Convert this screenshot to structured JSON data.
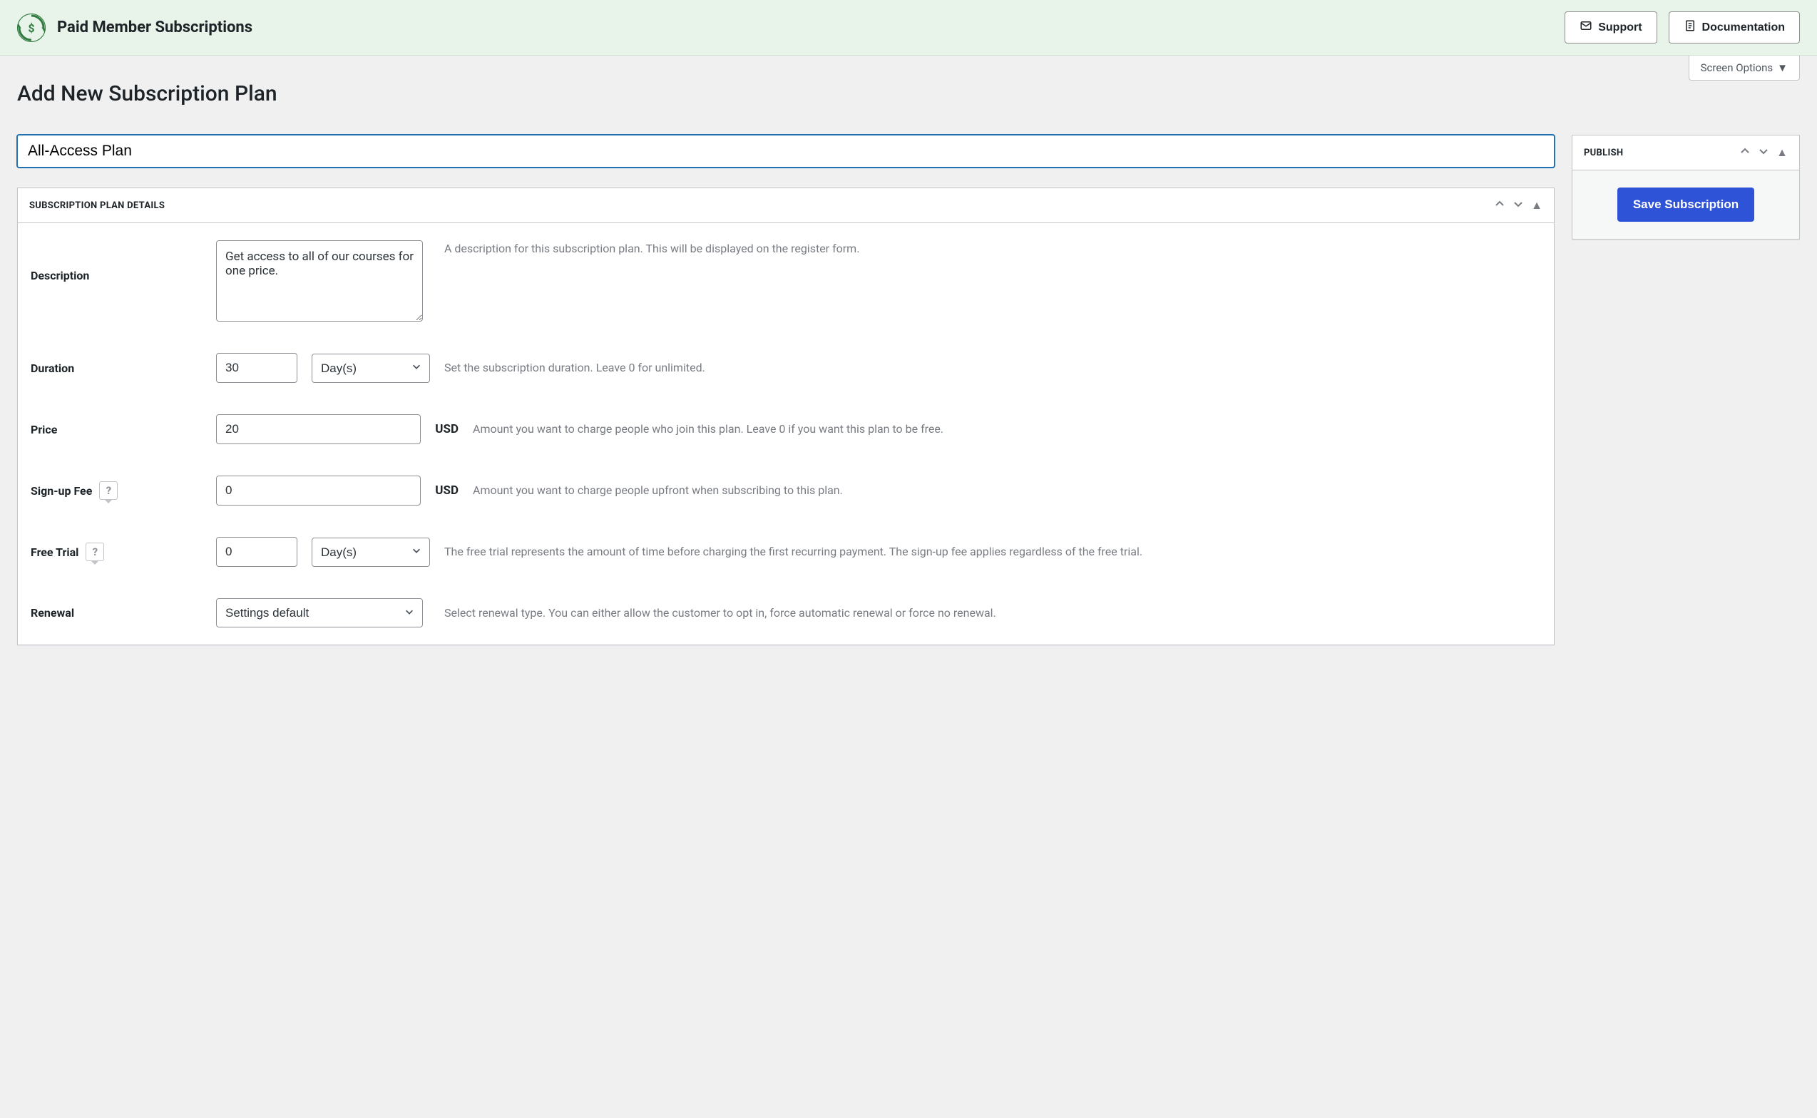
{
  "banner": {
    "title": "Paid Member Subscriptions",
    "support_label": "Support",
    "documentation_label": "Documentation"
  },
  "screen_options_label": "Screen Options",
  "page_title": "Add New Subscription Plan",
  "title_input_value": "All-Access Plan",
  "metabox_details": {
    "title": "SUBSCRIPTION PLAN DETAILS"
  },
  "publish_box": {
    "title": "PUBLISH",
    "save_label": "Save Subscription"
  },
  "fields": {
    "description": {
      "label": "Description",
      "value": "Get access to all of our courses for one price.",
      "helper": "A description for this subscription plan. This will be displayed on the register form."
    },
    "duration": {
      "label": "Duration",
      "value": "30",
      "unit": "Day(s)",
      "helper": "Set the subscription duration. Leave 0 for unlimited."
    },
    "price": {
      "label": "Price",
      "value": "20",
      "currency": "USD",
      "helper": "Amount you want to charge people who join this plan. Leave 0 if you want this plan to be free."
    },
    "signup_fee": {
      "label": "Sign-up Fee",
      "value": "0",
      "currency": "USD",
      "helper": "Amount you want to charge people upfront when subscribing to this plan."
    },
    "free_trial": {
      "label": "Free Trial",
      "value": "0",
      "unit": "Day(s)",
      "helper": "The free trial represents the amount of time before charging the first recurring payment. The sign-up fee applies regardless of the free trial."
    },
    "renewal": {
      "label": "Renewal",
      "value": "Settings default",
      "helper": "Select renewal type. You can either allow the customer to opt in, force automatic renewal or force no renewal."
    }
  }
}
